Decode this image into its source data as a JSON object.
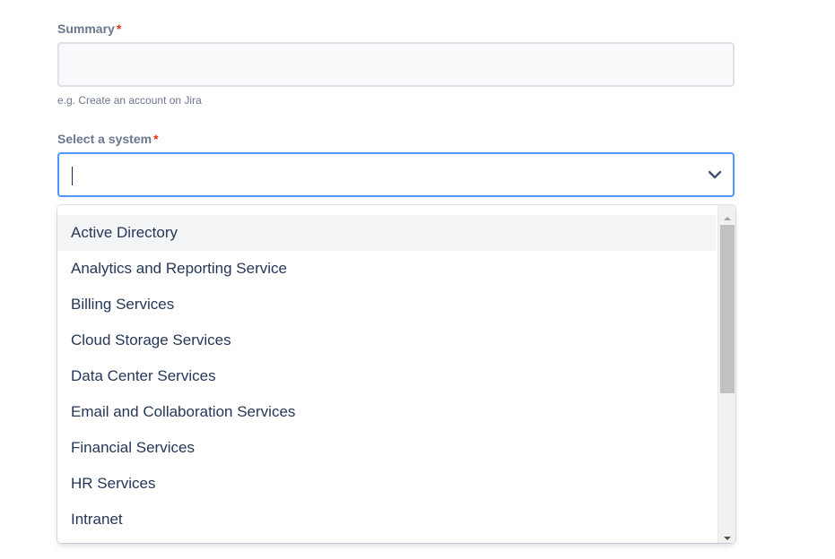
{
  "summary": {
    "label": "Summary",
    "required_mark": "*",
    "value": "",
    "helper": "e.g. Create an account on Jira"
  },
  "system": {
    "label": "Select a system",
    "required_mark": "*",
    "value": "",
    "options": [
      "Active Directory",
      "Analytics and Reporting Service",
      "Billing Services",
      "Cloud Storage Services",
      "Data Center Services",
      "Email and Collaboration Services",
      "Financial Services",
      "HR Services",
      "Intranet"
    ],
    "focused_index": 0,
    "chevron_icon": "chevron-down-icon"
  },
  "colors": {
    "label": "#6b778c",
    "required": "#de350b",
    "focus_border": "#4c9aff",
    "input_bg": "#f8f9fb",
    "option_hover": "#f4f5f7"
  }
}
